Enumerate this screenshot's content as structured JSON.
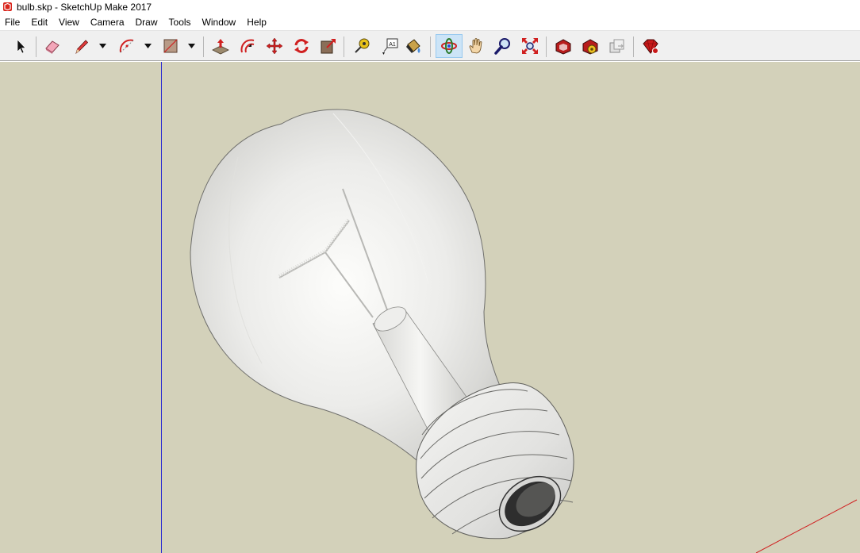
{
  "window": {
    "title": "bulb.skp - SketchUp Make 2017",
    "app_icon": "sketchup-logo-icon"
  },
  "menu": {
    "items": [
      "File",
      "Edit",
      "View",
      "Camera",
      "Draw",
      "Tools",
      "Window",
      "Help"
    ]
  },
  "toolbar": {
    "tools": [
      {
        "name": "select",
        "icon": "select-arrow-icon"
      },
      {
        "name": "eraser",
        "icon": "eraser-icon"
      },
      {
        "name": "line",
        "icon": "pencil-icon"
      },
      {
        "name": "arc",
        "icon": "arc-icon"
      },
      {
        "name": "rectangle",
        "icon": "rectangle-icon"
      },
      {
        "name": "push-pull",
        "icon": "push-pull-icon"
      },
      {
        "name": "offset",
        "icon": "offset-icon"
      },
      {
        "name": "move",
        "icon": "move-icon"
      },
      {
        "name": "rotate",
        "icon": "rotate-icon"
      },
      {
        "name": "scale",
        "icon": "scale-icon"
      },
      {
        "name": "tape-measure",
        "icon": "tape-measure-icon"
      },
      {
        "name": "text",
        "icon": "text-label-icon"
      },
      {
        "name": "paint-bucket",
        "icon": "paint-bucket-icon"
      },
      {
        "name": "orbit",
        "icon": "orbit-icon",
        "active": true
      },
      {
        "name": "pan",
        "icon": "pan-hand-icon"
      },
      {
        "name": "zoom",
        "icon": "zoom-magnifier-icon"
      },
      {
        "name": "zoom-extents",
        "icon": "zoom-extents-icon"
      },
      {
        "name": "3d-warehouse",
        "icon": "warehouse-icon"
      },
      {
        "name": "extension-warehouse",
        "icon": "extension-warehouse-icon"
      },
      {
        "name": "share-model",
        "icon": "share-model-icon"
      },
      {
        "name": "extension-manager",
        "icon": "ruby-extension-icon"
      }
    ],
    "text_tool_label": "A1"
  },
  "viewport": {
    "background_color": "#d3d1ba",
    "blue_axis_color": "#2b2bd0",
    "red_axis_color": "#d02020",
    "model": "light-bulb"
  }
}
